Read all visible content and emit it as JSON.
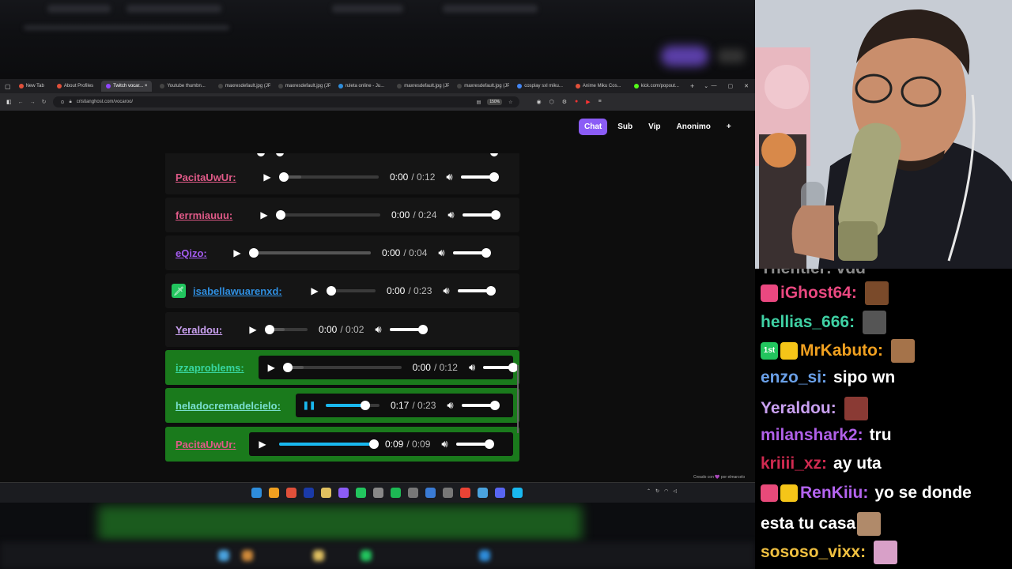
{
  "browser": {
    "tabs": [
      {
        "label": "New Tab",
        "color": "#e0503a"
      },
      {
        "label": "About Profiles",
        "color": "#e0503a"
      },
      {
        "label": "Twitch vocar... ×",
        "color": "#9146ff",
        "active": true
      },
      {
        "label": "Youtube thumbn...",
        "color": "#444444"
      },
      {
        "label": "maxresdefault.jpg (JP...",
        "color": "#444444"
      },
      {
        "label": "maxresdefault.jpg (JP...",
        "color": "#444444"
      },
      {
        "label": "ruleta online - Ju...",
        "color": "#2e8ddb"
      },
      {
        "label": "maxresdefault.jpg (JP...",
        "color": "#444444"
      },
      {
        "label": "maxresdefault.jpg (JP...",
        "color": "#444444"
      },
      {
        "label": "cosplay sxl miku...",
        "color": "#4285f4"
      },
      {
        "label": "Anime Miku Cos...",
        "color": "#e0503a"
      },
      {
        "label": "kick.com/popout...",
        "color": "#53fc18"
      }
    ],
    "new_tab_glyph": "+",
    "url": "cristianghost.com/vocaroo/",
    "zoom": "150%"
  },
  "page": {
    "tabs": [
      "Chat",
      "Sub",
      "Vip",
      "Anonimo",
      "+"
    ],
    "credit": "Creado con 💜 por elmarcelo"
  },
  "rows": [
    {
      "user": "PacitaUwUr:",
      "color": "#e05a88",
      "time": "0:00",
      "duration": "/ 0:12",
      "progress": 0,
      "buffered": 0.18
    },
    {
      "user": "ferrmiauuu:",
      "color": "#e05a88",
      "time": "0:00",
      "duration": "/ 0:24",
      "progress": 0,
      "buffered": 0.0
    },
    {
      "user": "eQizo:",
      "color": "#a45cf0",
      "time": "0:00",
      "duration": "/ 0:04",
      "progress": 0,
      "buffered": 1.0
    },
    {
      "user": "isabellawuarenxd:",
      "color": "#2f8fe0",
      "time": "0:00",
      "duration": "/ 0:23",
      "progress": 0,
      "buffered": 0.0,
      "badge": true
    },
    {
      "user": "Yeraldou:",
      "color": "#c9a0f0",
      "time": "0:00",
      "duration": "/ 0:02",
      "progress": 0,
      "buffered": 0.4
    },
    {
      "user": "izzaproblems:",
      "color": "#38d6a0",
      "time": "0:00",
      "duration": "/ 0:12",
      "progress": 0,
      "buffered": 0.14,
      "highlight": true
    },
    {
      "user": "heladocremadelcielo:",
      "color": "#7ae0d0",
      "time": "0:17",
      "duration": "/ 0:23",
      "progress": 0.74,
      "buffered": 0.74,
      "highlight": true,
      "playing": true
    },
    {
      "user": "PacitaUwUr:",
      "color": "#e05a88",
      "time": "0:09",
      "duration": "/ 0:09",
      "progress": 1.0,
      "buffered": 1.0,
      "highlight": true
    }
  ],
  "chat": [
    {
      "user": "iGhost64:",
      "color": "#ea4880",
      "text": "",
      "badges": [
        "sword"
      ],
      "emote": "#7a4a2a"
    },
    {
      "user": "hellias_666:",
      "color": "#3fd1a4",
      "text": "",
      "badges": [],
      "emote": "#555555"
    },
    {
      "user": "MrKabuto:",
      "color": "#f0a020",
      "text": "",
      "badges": [
        "1st",
        "sunglasses"
      ],
      "emote": "#a5734a"
    },
    {
      "user": "enzo_si:",
      "color": "#6aa0e8",
      "text": "sipo wn",
      "badges": [],
      "emote": ""
    },
    {
      "user": "Yeraldou:",
      "color": "#c9a0f0",
      "text": "",
      "badges": [],
      "emote": "#8a3a34"
    },
    {
      "user": "milanshark2:",
      "color": "#b060e8",
      "text": "tru",
      "badges": [],
      "emote": ""
    },
    {
      "user": "kriiii_xz:",
      "color": "#d02a50",
      "text": "ay uta",
      "badges": [],
      "emote": ""
    },
    {
      "user": "RenKiiu:",
      "color": "#b464f0",
      "text": "yo se donde",
      "badges": [
        "gem",
        "sunglasses"
      ],
      "emote": ""
    },
    {
      "user": "",
      "color": "#ffffff",
      "text": "esta tu casa",
      "badges": [],
      "emote": "#b08a6a"
    },
    {
      "user": "sososo_vixx:",
      "color": "#f0c040",
      "text": "",
      "badges": [],
      "emote": "#d8a0c8"
    }
  ],
  "chat_partial_top": "Thentier: vdd",
  "badge_labels": {
    "first": "1st"
  }
}
